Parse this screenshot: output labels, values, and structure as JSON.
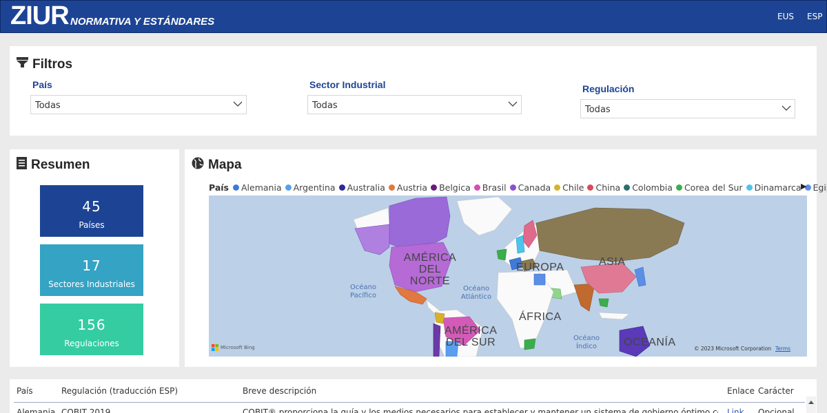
{
  "header": {
    "logo": "ZIUR",
    "subtitle": "NORMATIVA Y ESTÁNDARES",
    "lang_eus": "EUS",
    "lang_esp": "ESP",
    "bg_color": "#1d4494"
  },
  "filters": {
    "title": "Filtros",
    "icon": "funnel-icon",
    "items": [
      {
        "label": "País",
        "value": "Todas"
      },
      {
        "label": "Sector Industrial",
        "value": "Todas"
      },
      {
        "label": "Regulación",
        "value": "Todas"
      }
    ]
  },
  "summary": {
    "title": "Resumen",
    "icon": "document-icon",
    "kpis": [
      {
        "value": "45",
        "label": "Países",
        "color": "#1d4494"
      },
      {
        "value": "17",
        "label": "Sectores Industriales",
        "color": "#34a3c4"
      },
      {
        "value": "156",
        "label": "Regulaciones",
        "color": "#35cca2"
      }
    ]
  },
  "map": {
    "title": "Mapa",
    "icon": "globe-icon",
    "legend_title": "País",
    "legend": [
      {
        "name": "Alemania",
        "color": "#3f7ad6"
      },
      {
        "name": "Argentina",
        "color": "#5b9ef0"
      },
      {
        "name": "Australia",
        "color": "#2b2b9c"
      },
      {
        "name": "Austria",
        "color": "#e07840"
      },
      {
        "name": "Belgica",
        "color": "#6b1b7a"
      },
      {
        "name": "Brasil",
        "color": "#d44fb0"
      },
      {
        "name": "Canada",
        "color": "#8c4fd0"
      },
      {
        "name": "Chile",
        "color": "#d6b22a"
      },
      {
        "name": "China",
        "color": "#d84a5a"
      },
      {
        "name": "Colombia",
        "color": "#2b6e6e"
      },
      {
        "name": "Corea del Sur",
        "color": "#3cad4c"
      },
      {
        "name": "Dinamarca",
        "color": "#4ec4ea"
      },
      {
        "name": "Egipto",
        "color": "#5b8ee6"
      }
    ],
    "regions": {
      "north_america": "AMÉRICA DEL NORTE",
      "europe": "EUROPA",
      "asia": "ASIA",
      "africa": "ÁFRICA",
      "south_america": "AMÉRICA DEL SUR",
      "oceania": "OCEANÍA"
    },
    "oceans": {
      "pacific": "Océano Pacífico",
      "atlantic": "Océano Atlántico",
      "indian": "Océano Índico"
    },
    "attribution_left": "Microsoft Bing",
    "attribution_right": "© 2023 Microsoft Corporation",
    "terms": "Terms"
  },
  "table": {
    "columns": [
      "País",
      "Regulación (traducción ESP)",
      "Breve descripción",
      "Enlace",
      "Carácter"
    ],
    "rows": [
      [
        "Alemania",
        "COBIT 2019",
        "COBIT® proporciona la guía y los medios necesarios para establecer y mantener un sistema de gobierno óptimo conforme a",
        "Link",
        "Opcional"
      ]
    ]
  }
}
